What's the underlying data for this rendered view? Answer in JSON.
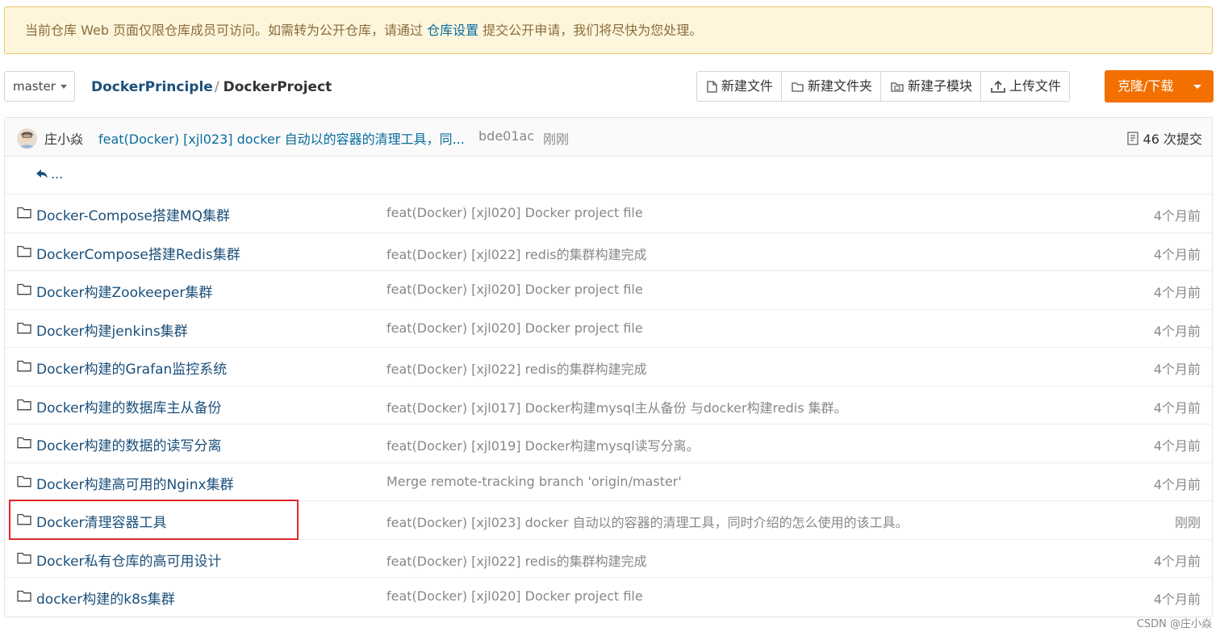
{
  "notice": {
    "text_before": "当前仓库 Web 页面仅限仓库成员可访问。如需转为公开仓库，请通过 ",
    "link": "仓库设置",
    "text_after": " 提交公开申请，我们将尽快为您处理。"
  },
  "branch": {
    "label": "master"
  },
  "breadcrumb": {
    "parent": "DockerPrinciple",
    "separator": "/",
    "current": "DockerProject"
  },
  "toolbar": {
    "new_file": "新建文件",
    "new_folder": "新建文件夹",
    "new_submodule": "新建子模块",
    "upload_file": "上传文件",
    "clone": "克隆/下载"
  },
  "last_commit": {
    "author": "庄小焱",
    "message": "feat(Docker) [xjl023] docker 自动以的容器的清理工具，同...",
    "sha": "bde01ac",
    "time": "刚刚",
    "commit_count": "46 次提交"
  },
  "back_label": "...",
  "files": [
    {
      "name": "Docker-Compose搭建MQ集群",
      "message": "feat(Docker) [xjl020] Docker project file",
      "time": "4个月前"
    },
    {
      "name": "DockerCompose搭建Redis集群",
      "message": "feat(Docker) [xjl022] redis的集群构建完成",
      "time": "4个月前"
    },
    {
      "name": "Docker构建Zookeeper集群",
      "message": "feat(Docker) [xjl020] Docker project file",
      "time": "4个月前"
    },
    {
      "name": "Docker构建jenkins集群",
      "message": "feat(Docker) [xjl020] Docker project file",
      "time": "4个月前"
    },
    {
      "name": "Docker构建的Grafan监控系统",
      "message": "feat(Docker) [xjl022] redis的集群构建完成",
      "time": "4个月前"
    },
    {
      "name": "Docker构建的数据库主从备份",
      "message": "feat(Docker) [xjl017] Docker构建mysql主从备份 与docker构建redis 集群。",
      "time": "4个月前"
    },
    {
      "name": "Docker构建的数据的读写分离",
      "message": "feat(Docker) [xjl019] Docker构建mysql读写分离。",
      "time": "4个月前"
    },
    {
      "name": "Docker构建高可用的Nginx集群",
      "message": "Merge remote-tracking branch 'origin/master'",
      "time": "4个月前"
    },
    {
      "name": "Docker清理容器工具",
      "message": "feat(Docker) [xjl023] docker 自动以的容器的清理工具，同时介绍的怎么使用的该工具。",
      "time": "刚刚"
    },
    {
      "name": "Docker私有仓库的高可用设计",
      "message": "feat(Docker) [xjl022] redis的集群构建完成",
      "time": "4个月前"
    },
    {
      "name": "docker构建的k8s集群",
      "message": "feat(Docker) [xjl020] Docker project file",
      "time": "4个月前"
    }
  ],
  "watermark": "CSDN @庄小焱",
  "colors": {
    "accent": "#f26f00",
    "link": "#1b4f7a",
    "highlight": "#e0262a",
    "notice_bg": "#fdf6dc"
  }
}
